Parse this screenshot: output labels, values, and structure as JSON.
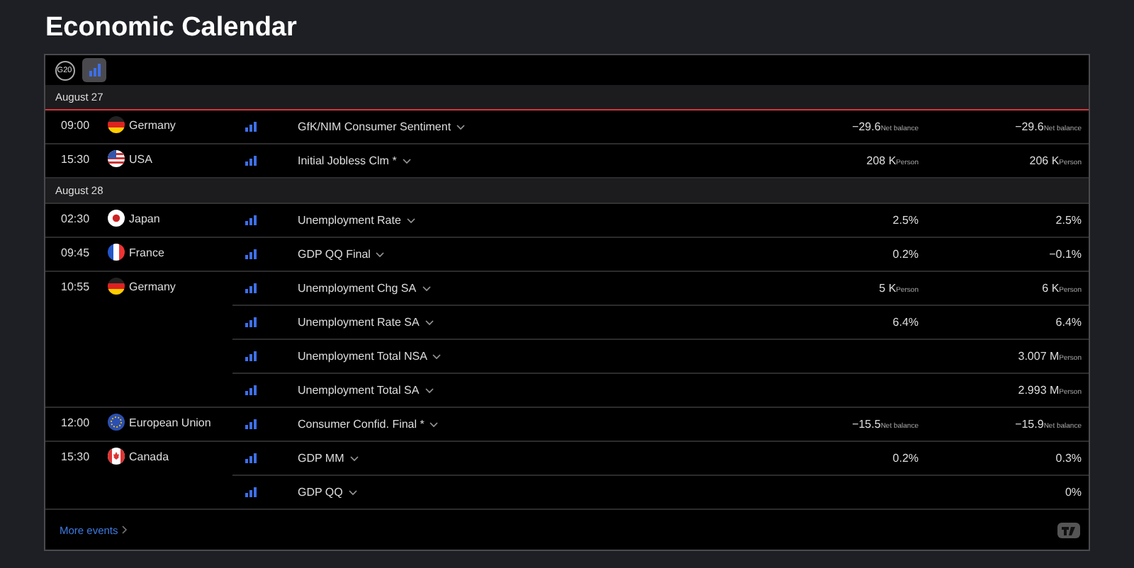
{
  "title": "Economic Calendar",
  "filters": [
    {
      "kind": "g20",
      "label": "G20",
      "selected": false
    },
    {
      "kind": "importance",
      "selected": true
    }
  ],
  "days": [
    {
      "date": "August 27",
      "now_marker": true,
      "groups": [
        {
          "time": "09:00",
          "kind": "germany",
          "country": "Germany",
          "events": [
            {
              "name": "GfK/NIM Consumer Sentiment",
              "actual": "−29.6",
              "actual_unit": "Net balance",
              "forecast": "−29.6",
              "forecast_unit": "Net balance"
            }
          ]
        },
        {
          "time": "15:30",
          "kind": "usa",
          "country": "USA",
          "events": [
            {
              "name": "Initial Jobless Clm *",
              "actual": "208 K",
              "actual_unit": "Person",
              "forecast": "206 K",
              "forecast_unit": "Person"
            }
          ]
        }
      ]
    },
    {
      "date": "August 28",
      "now_marker": false,
      "groups": [
        {
          "time": "02:30",
          "kind": "japan",
          "country": "Japan",
          "events": [
            {
              "name": "Unemployment Rate",
              "actual": "2.5%",
              "forecast": "2.5%"
            }
          ]
        },
        {
          "time": "09:45",
          "kind": "france",
          "country": "France",
          "events": [
            {
              "name": "GDP QQ Final",
              "actual": "0.2%",
              "forecast": "−0.1%"
            }
          ]
        },
        {
          "time": "10:55",
          "kind": "germany",
          "country": "Germany",
          "events": [
            {
              "name": "Unemployment Chg SA",
              "actual": "5 K",
              "actual_unit": "Person",
              "forecast": "6 K",
              "forecast_unit": "Person"
            },
            {
              "name": "Unemployment Rate SA",
              "actual": "6.4%",
              "forecast": "6.4%"
            },
            {
              "name": "Unemployment Total NSA",
              "forecast": "3.007 M",
              "forecast_unit": "Person"
            },
            {
              "name": "Unemployment Total SA",
              "forecast": "2.993 M",
              "forecast_unit": "Person"
            }
          ]
        },
        {
          "time": "12:00",
          "kind": "eu",
          "country": "European Union",
          "events": [
            {
              "name": "Consumer Confid. Final *",
              "actual": "−15.5",
              "actual_unit": "Net balance",
              "forecast": "−15.9",
              "forecast_unit": "Net balance"
            }
          ]
        },
        {
          "time": "15:30",
          "kind": "canada",
          "country": "Canada",
          "events": [
            {
              "name": "GDP MM",
              "actual": "0.2%",
              "forecast": "0.3%"
            },
            {
              "name": "GDP QQ",
              "forecast": "0%"
            }
          ]
        }
      ]
    }
  ],
  "more_link": "More events"
}
